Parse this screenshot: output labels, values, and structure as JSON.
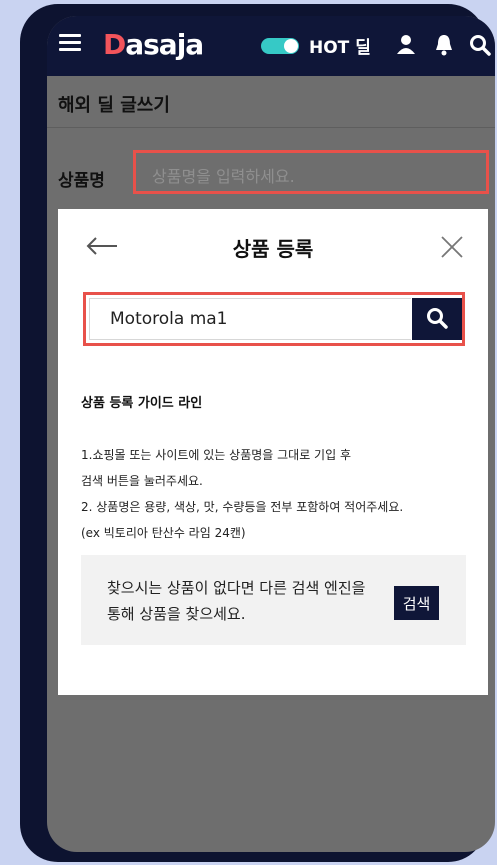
{
  "header": {
    "logo_accent": "D",
    "logo_rest": "asaja",
    "hot_deal_label": "HOT 딜",
    "icons": [
      "menu-icon",
      "toggle-switch",
      "user-icon",
      "bell-icon",
      "search-icon"
    ]
  },
  "page": {
    "title": "해외 딜 글쓰기",
    "product_name_label": "상품명",
    "product_name_placeholder": "상품명을 입력하세요."
  },
  "modal": {
    "title": "상품 등록",
    "search_value": "Motorola ma1",
    "guide_title": "상품 등록 가이드 라인",
    "guide_lines": [
      "1.쇼핑몰 또는 사이트에 있는 상품명을 그대로 기입 후",
      "검색 버튼을 눌러주세요.",
      "2. 상품명은 용량, 색상, 맛, 수량등을 전부 포함하여 적어주세요.",
      "(ex 빅토리아 탄산수 라임 24캔)"
    ],
    "info_text": "찾으시는 상품이 없다면 다른 검색 엔진을 통해 상품을 찾으세요.",
    "info_button": "검색"
  },
  "colors": {
    "navy": "#0f1638",
    "accent_red": "#e8514a",
    "toggle": "#36c9c6",
    "frame_bg": "#c9d3f1"
  }
}
